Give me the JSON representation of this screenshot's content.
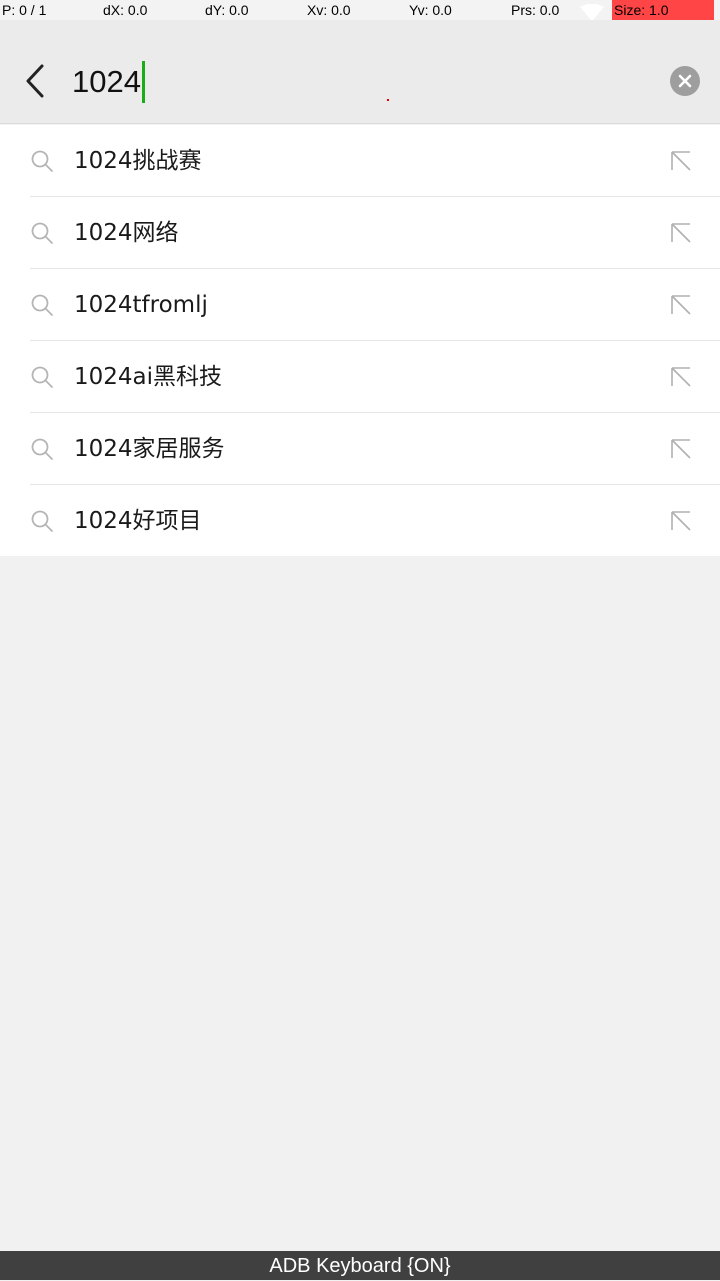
{
  "debug": {
    "pointer": "P: 0 / 1",
    "dx": "dX: 0.0",
    "dy": "dY: 0.0",
    "xv": "Xv: 0.0",
    "yv": "Yv: 0.0",
    "prs": "Prs: 0.0",
    "size": "Size: 1.0"
  },
  "search": {
    "value": "1024"
  },
  "suggestions": [
    "1024挑战赛",
    "1024网络",
    "1024tfromlj",
    "1024ai黑科技",
    "1024家居服务",
    "1024好项目"
  ],
  "icons": {
    "back": "back-arrow-icon",
    "clear": "clear-circle-icon",
    "search": "search-icon",
    "fill": "arrow-up-left-icon"
  },
  "colors": {
    "caret": "#1aad19",
    "debug_size_bg": "#ff4545",
    "bottom_bar": "#404040"
  },
  "keyboard_bar": {
    "label": "ADB Keyboard {ON}"
  }
}
